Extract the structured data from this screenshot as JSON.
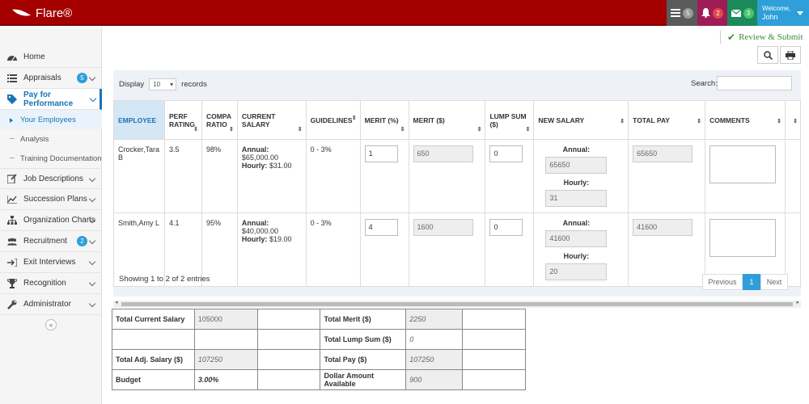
{
  "app": {
    "title": "Flare®"
  },
  "topbar": {
    "tasks_count": "5",
    "alerts_count": "2",
    "messages_count": "3",
    "welcome": "Welcome,",
    "user": "John"
  },
  "sidebar": {
    "items": [
      {
        "label": "Home",
        "icon": "dashboard-icon"
      },
      {
        "label": "Appraisals",
        "icon": "list-icon",
        "badge": "5"
      },
      {
        "label": "Pay for Performance",
        "icon": "tag-icon"
      },
      {
        "label": "Job Descriptions",
        "icon": "edit-icon"
      },
      {
        "label": "Succession Plans",
        "icon": "chart-line-icon"
      },
      {
        "label": "Organization Charts",
        "icon": "sitemap-icon"
      },
      {
        "label": "Recruitment",
        "icon": "users-icon",
        "badge": "2"
      },
      {
        "label": "Exit Interviews",
        "icon": "exit-icon"
      },
      {
        "label": "Recognition",
        "icon": "trophy-icon"
      },
      {
        "label": "Administrator",
        "icon": "wrench-icon"
      }
    ],
    "subitems": [
      {
        "label": "Your Employees"
      },
      {
        "label": "Analysis"
      },
      {
        "label": "Training Documentation"
      }
    ]
  },
  "actions": {
    "review_submit": "Review & Submit"
  },
  "table_controls": {
    "display_label": "Display",
    "page_size": "10",
    "records_label": "records",
    "search_label": "Search:"
  },
  "columns": [
    "EMPLOYEE",
    "PERF RATING",
    "COMPA RATIO",
    "CURRENT SALARY",
    "GUIDELINES",
    "MERIT (%)",
    "MERIT ($)",
    "LUMP SUM ($)",
    "NEW SALARY",
    "TOTAL PAY",
    "COMMENTS",
    ""
  ],
  "rows": [
    {
      "employee": "Crocker,Tara B",
      "perf_rating": "3.5",
      "compa_ratio": "98%",
      "annual_label": "Annual:",
      "annual": "$65,000.00",
      "hourly_label": "Hourly:",
      "hourly": "$31.00",
      "guidelines": "0 - 3%",
      "merit_pct": "1",
      "merit_amt": "650",
      "lump_sum": "0",
      "new_annual": "65650",
      "new_hourly": "31",
      "total_pay": "65650"
    },
    {
      "employee": "Smith,Amy L",
      "perf_rating": "4.1",
      "compa_ratio": "95%",
      "annual_label": "Annual:",
      "annual": "$40,000.00",
      "hourly_label": "Hourly:",
      "hourly": "$19.00",
      "guidelines": "0 - 3%",
      "merit_pct": "4",
      "merit_amt": "1600",
      "lump_sum": "0",
      "new_annual": "41600",
      "new_hourly": "20",
      "total_pay": "41600"
    }
  ],
  "footer": {
    "showing": "Showing 1 to 2 of 2 entries",
    "previous": "Previous",
    "page": "1",
    "next": "Next"
  },
  "totals": {
    "total_current_salary_label": "Total Current Salary",
    "total_current_salary": "105000",
    "total_merit_label": "Total Merit ($)",
    "total_merit": "2250",
    "total_lump_sum_label": "Total Lump Sum ($)",
    "total_lump_sum": "0",
    "total_adj_salary_label": "Total Adj. Salary ($)",
    "total_adj_salary": "107250",
    "total_pay_label": "Total Pay ($)",
    "total_pay": "107250",
    "budget_label": "Budget",
    "budget": "3.00%",
    "dollar_available_label": "Dollar Amount Available",
    "dollar_available": "900"
  }
}
